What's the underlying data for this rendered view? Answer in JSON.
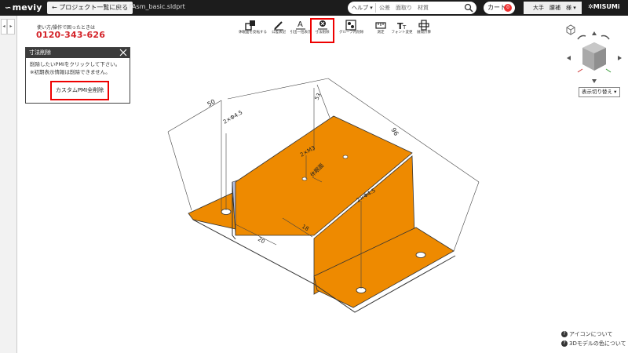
{
  "header": {
    "logo": "meviy",
    "back_label": "プロジェクト一覧に戻る",
    "filename": "10_FAsm_basic.sldprt",
    "search": {
      "help_label": "ヘルプ",
      "placeholder": "公差　面取り　材質"
    },
    "cart_label": "カート",
    "cart_count": "0",
    "user_label": "大手　腰補　様",
    "brand": "MISUMi"
  },
  "support": {
    "title": "使い方/操作で困ったときは",
    "phone": "0120-343-626"
  },
  "panel": {
    "title": "寸法削除",
    "line1": "削除したいPMIをクリックして下さい。",
    "line2": "※初期表示情報は削除できません。",
    "button": "カスタムPMI全削除"
  },
  "toolbar": [
    {
      "label": "休眠面を反転する",
      "icon": "flip-face-icon"
    },
    {
      "label": "公差表記",
      "icon": "tolerance-icon"
    },
    {
      "label": "引出一括表示",
      "icon": "leader-text-icon"
    },
    {
      "label": "寸法削除",
      "icon": "dimension-delete-icon",
      "active": true
    },
    {
      "label": "グループ内削除",
      "icon": "group-delete-icon"
    },
    {
      "label": "測定",
      "icon": "measure-icon"
    },
    {
      "label": "フォント変更",
      "icon": "font-icon"
    },
    {
      "label": "展開計算",
      "icon": "unfold-icon"
    }
  ],
  "view": {
    "display_switch": "表示切り替え"
  },
  "help_links": [
    "アイコンについて",
    "3Dモデルの色について"
  ],
  "dimensions": {
    "d50": "50",
    "d96": "96",
    "d53": "53",
    "hole1": "2×Φ4.5",
    "hole2": "2×M3",
    "hole3": "2×Φ4.5",
    "face": "休眠面",
    "d20": "20",
    "d18": "18"
  },
  "colors": {
    "part": "#ee8a00",
    "inner": "#b4bfe0",
    "topbar": "#1c1c1c",
    "highlight": "#e00000"
  }
}
